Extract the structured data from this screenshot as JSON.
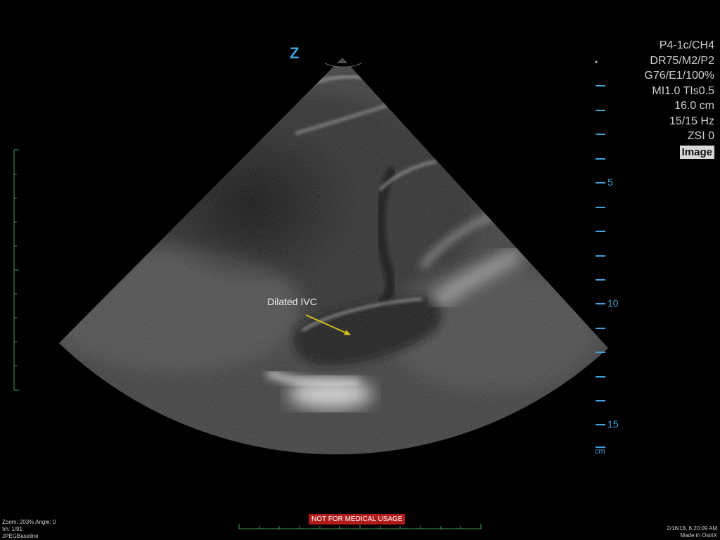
{
  "scanner_params": {
    "probe": "P4-1c/CH4",
    "dynamic_range": "DR75/M2/P2",
    "gain": "G76/E1/100%",
    "index": "MI1.0  TIs0.5",
    "depth": "16.0 cm",
    "frame_rate": "15/15 Hz",
    "zsi": "ZSI 0",
    "mode_badge": "Image"
  },
  "orientation_marker": "Z",
  "annotation": {
    "label": "Dilated IVC",
    "arrow_color": "#d6c21a"
  },
  "depth_scale": {
    "labels": [
      "5",
      "10",
      "15"
    ],
    "unit": "cm",
    "color": "#3fa2dd"
  },
  "viewer_overlay": {
    "zoom_angle": "Zoom: 203%  Angle: 0",
    "image_index": "Im: 1/91",
    "compression": "JPEGBaseline",
    "datetime": "2/16/18, 6:20:09 AM",
    "made_in": "Made in OsiriX",
    "warning": "NOT FOR MEDICAL USAGE",
    "warning_color": "#b01c1c"
  },
  "colors": {
    "scale_green": "#3f9a55",
    "depth_blue": "#3fa2dd"
  }
}
